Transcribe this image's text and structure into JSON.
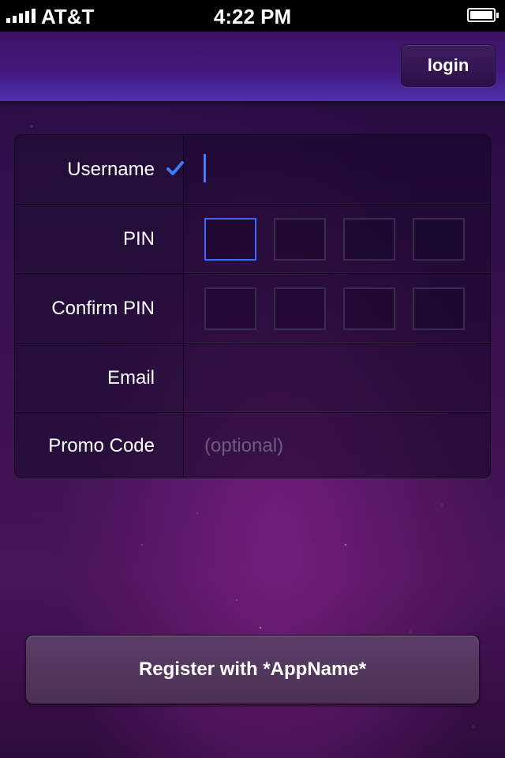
{
  "status_bar": {
    "carrier": "AT&T",
    "time": "4:22 PM",
    "signal_icon": "signal-bars-icon",
    "battery_icon": "battery-icon"
  },
  "nav_bar": {
    "login_label": "login"
  },
  "form": {
    "username": {
      "label": "Username",
      "value": "",
      "status_icon": "checkmark-icon",
      "status_color": "#3d7bff"
    },
    "pin": {
      "label": "PIN",
      "digits": 4
    },
    "confirm_pin": {
      "label": "Confirm PIN",
      "digits": 4
    },
    "email": {
      "label": "Email",
      "value": ""
    },
    "promo_code": {
      "label": "Promo Code",
      "placeholder": "(optional)"
    }
  },
  "register_label": "Register with *AppName*",
  "colors": {
    "accent": "#3d6bff",
    "nav_bar": "#45187a",
    "background": "#3a1050"
  }
}
